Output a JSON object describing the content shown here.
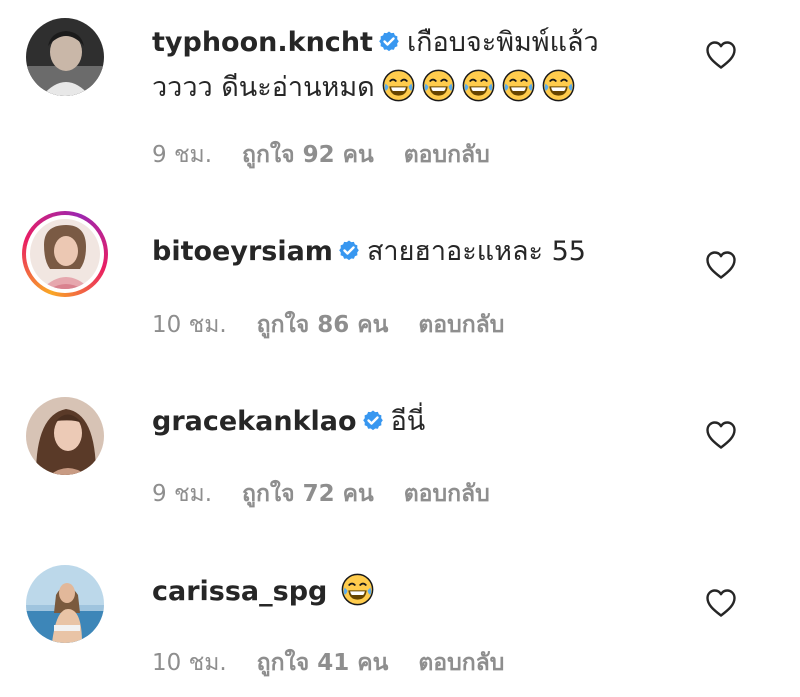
{
  "comments": [
    {
      "username": "typhoon.kncht",
      "text_line1": "เกือบจะพิมพ์แล้ว",
      "text_line2": "วววว ดีนะอ่านหมด",
      "emoji": "face-with-tears-of-joy-icon",
      "emoji_count": 5,
      "time": "9 ชม.",
      "likes": "ถูกใจ 92 คน",
      "reply": "ตอบกลับ",
      "verified": true,
      "story_ring": false
    },
    {
      "username": "bitoeyrsiam",
      "text_line1": "สายฮาอะแหละ 55",
      "time": "10 ชม.",
      "likes": "ถูกใจ 86 คน",
      "reply": "ตอบกลับ",
      "verified": true,
      "story_ring": true
    },
    {
      "username": "gracekanklao",
      "text_line1": "อีนี่",
      "time": "9 ชม.",
      "likes": "ถูกใจ 72 คน",
      "reply": "ตอบกลับ",
      "verified": true,
      "story_ring": false
    },
    {
      "username": "carissa_spg",
      "text_line1": "",
      "emoji": "face-with-tears-of-joy-icon",
      "emoji_count": 1,
      "time": "10 ชม.",
      "likes": "ถูกใจ 41 คน",
      "reply": "ตอบกลับ",
      "verified": false,
      "story_ring": false
    }
  ],
  "colors": {
    "text": "#262626",
    "meta": "#8e8e8e",
    "verified_blue": "#3897f0",
    "ring_gradient": [
      "#f9a825",
      "#e91e63",
      "#9c27b0"
    ]
  },
  "icons": {
    "like": "heart-outline-icon",
    "verified": "verified-badge-icon"
  }
}
